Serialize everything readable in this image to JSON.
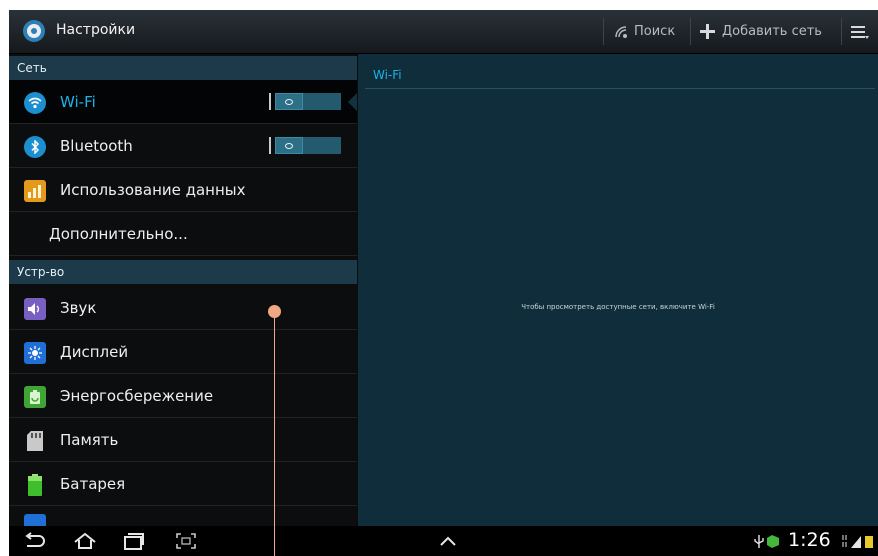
{
  "app": {
    "title": "Настройки",
    "icon": "gear-icon"
  },
  "actionbar": {
    "search_label": "Поиск",
    "add_label": "Добавить сеть",
    "search_icon": "scan-icon",
    "add_icon": "plus-icon",
    "menu_icon": "menu-icon"
  },
  "sidebar": {
    "section_network": "Сеть",
    "section_device": "Устр-во",
    "items": [
      {
        "label": "Wi-Fi",
        "icon": "wifi-icon",
        "toggle": "off",
        "selected": true
      },
      {
        "label": "Bluetooth",
        "icon": "bluetooth-icon",
        "toggle": "off"
      },
      {
        "label": "Использование данных",
        "icon": "data-usage-icon"
      },
      {
        "label": "Дополнительно..."
      },
      {
        "label": "Звук",
        "icon": "speaker-icon"
      },
      {
        "label": "Дисплей",
        "icon": "display-icon"
      },
      {
        "label": "Энергосбережение",
        "icon": "power-saving-icon"
      },
      {
        "label": "Память",
        "icon": "sd-card-icon"
      },
      {
        "label": "Батарея",
        "icon": "battery-icon"
      }
    ]
  },
  "detail": {
    "title": "Wi-Fi",
    "message": "Чтобы просмотреть доступные сети, включите Wi-Fi"
  },
  "statusbar": {
    "time": "1:26"
  },
  "colors": {
    "accent": "#1fb1e8",
    "section": "#1c3a4a",
    "panel": "#0f2d3a",
    "callout": "#f0a884"
  }
}
